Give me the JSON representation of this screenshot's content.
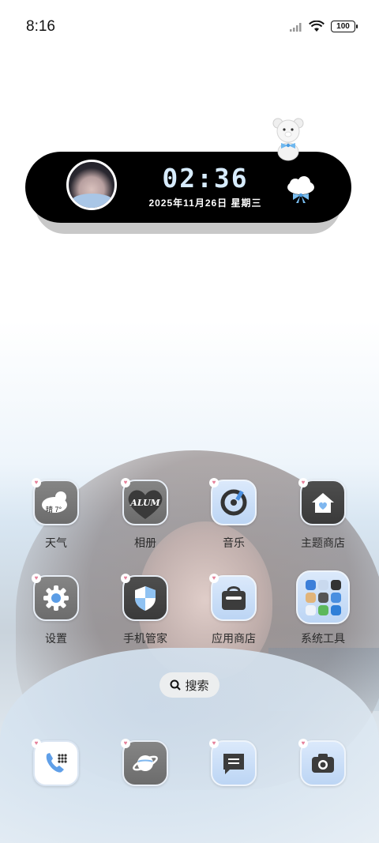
{
  "status_bar": {
    "time": "8:16",
    "battery": "100",
    "icons": [
      "signal-icon",
      "wifi-icon",
      "battery-icon"
    ]
  },
  "clock_widget": {
    "time": "02:36",
    "date": "2025年11月26日 星期三",
    "icons": [
      "avatar",
      "bear-icon",
      "cloud-bow-icon"
    ]
  },
  "apps": [
    {
      "label": "天气",
      "icon": "weather-icon",
      "icon_text": "晴 7°"
    },
    {
      "label": "相册",
      "icon": "gallery-icon",
      "icon_text": "ALUM"
    },
    {
      "label": "音乐",
      "icon": "music-icon"
    },
    {
      "label": "主题商店",
      "icon": "theme-store-icon"
    },
    {
      "label": "设置",
      "icon": "settings-icon"
    },
    {
      "label": "手机管家",
      "icon": "phone-manager-icon"
    },
    {
      "label": "应用商店",
      "icon": "app-store-icon"
    },
    {
      "label": "系统工具",
      "icon": "system-tools-folder-icon"
    }
  ],
  "search": {
    "label": "搜索",
    "icon": "search-icon"
  },
  "dock": [
    {
      "icon": "phone-icon"
    },
    {
      "icon": "browser-icon"
    },
    {
      "icon": "messages-icon"
    },
    {
      "icon": "camera-icon"
    }
  ],
  "colors": {
    "widget_bg": "#000000",
    "widget_time": "#d7ecff",
    "accent_blue": "#4a8fe0",
    "heart_pink": "#e5809a"
  }
}
